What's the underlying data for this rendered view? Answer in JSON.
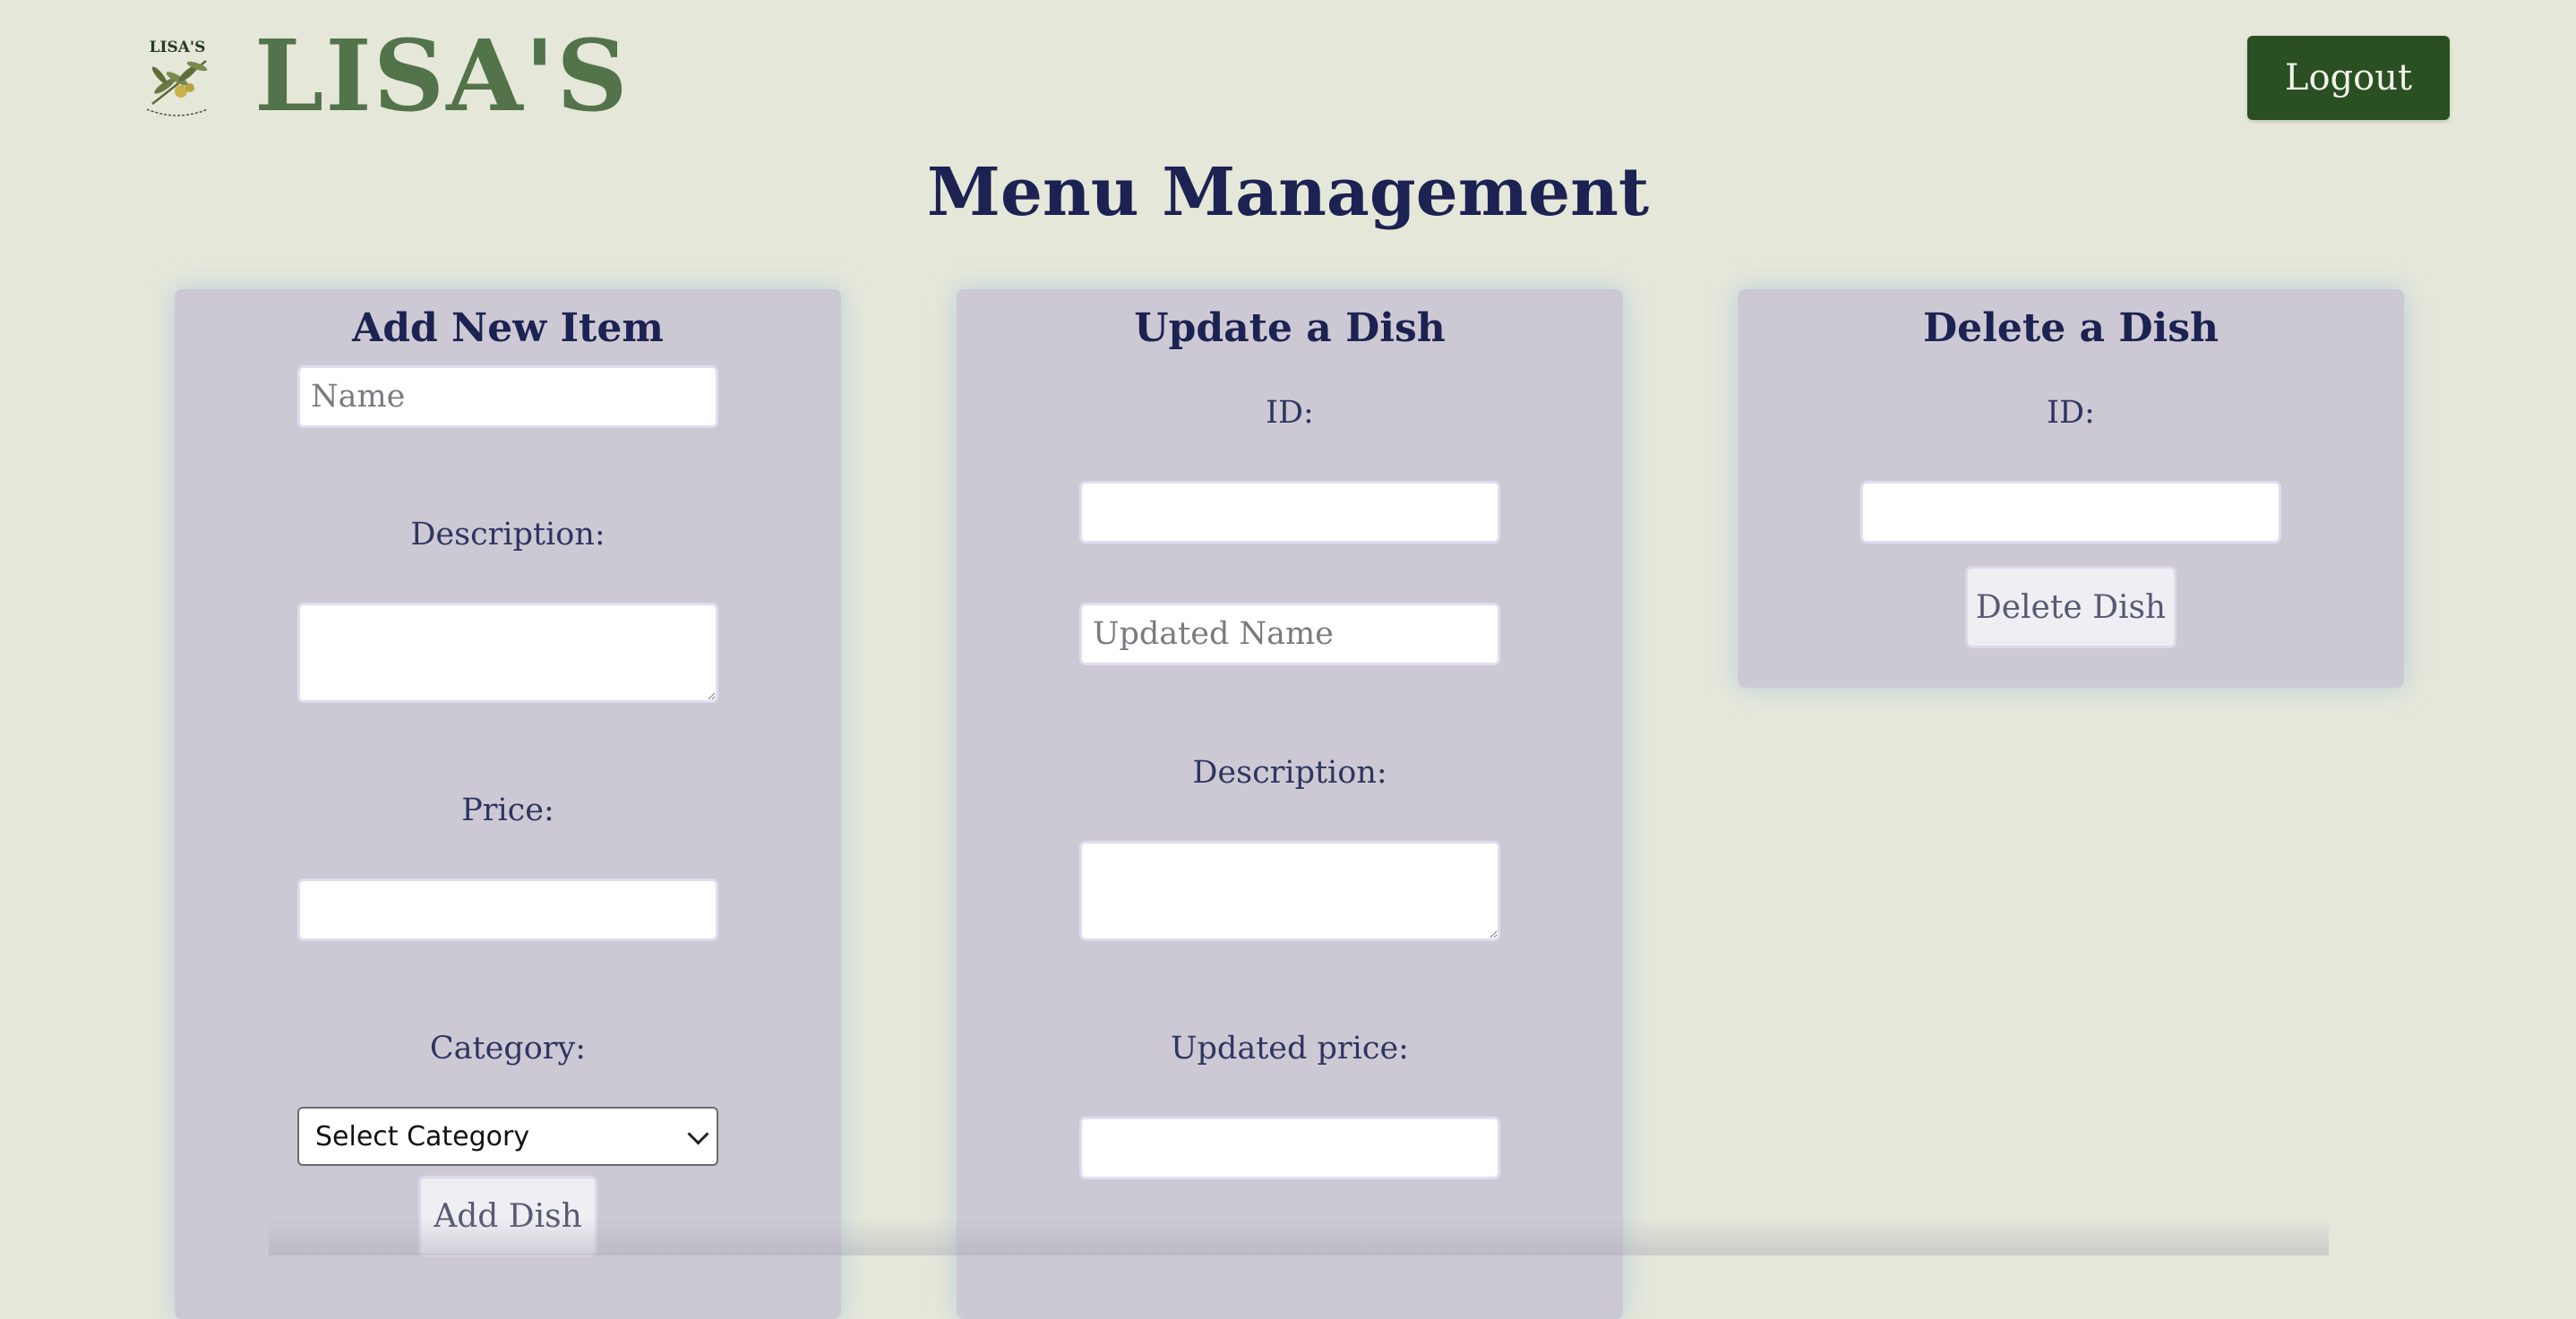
{
  "header": {
    "brand": "LISA'S",
    "logo_text": "LISA'S",
    "logout_label": "Logout"
  },
  "page": {
    "title": "Menu Management"
  },
  "add_panel": {
    "title": "Add New Item",
    "name_placeholder": "Name",
    "description_label": "Description:",
    "price_label": "Price:",
    "category_label": "Category:",
    "category_selected": "Select Category",
    "submit_label": "Add Dish"
  },
  "update_panel": {
    "title": "Update a Dish",
    "id_label": "ID:",
    "name_placeholder": "Updated Name",
    "description_label": "Description:",
    "price_label": "Updated price:"
  },
  "delete_panel": {
    "title": "Delete a Dish",
    "id_label": "ID:",
    "submit_label": "Delete Dish"
  },
  "colors": {
    "background": "#e5e7d9",
    "brand_green": "#53734b",
    "logout_green": "#2a4f22",
    "panel": "#cdc9d4",
    "title_navy": "#1c2252"
  }
}
